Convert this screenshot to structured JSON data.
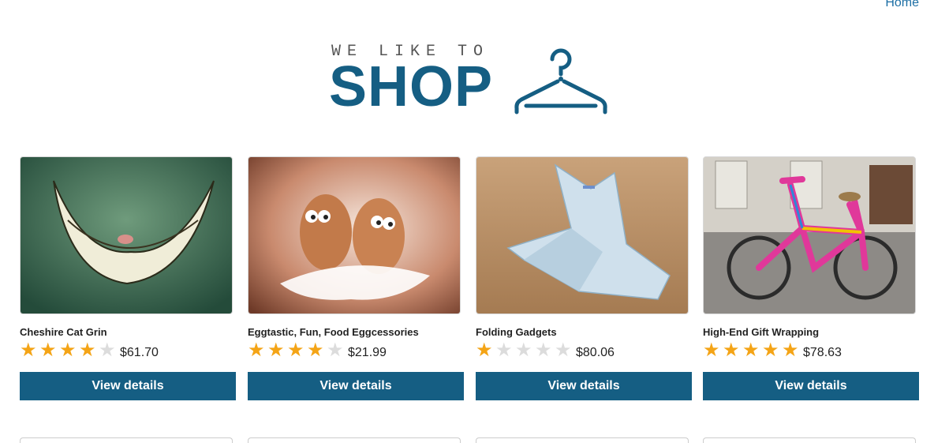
{
  "nav": {
    "home": "Home"
  },
  "logo": {
    "tagline": "WE LIKE TO",
    "wordmark": "SHOP",
    "icon": "hanger-icon"
  },
  "colors": {
    "brand": "#155e83",
    "star": "#f4a416",
    "star_off": "#dcdcdc",
    "link": "#1c6ea4"
  },
  "products": [
    {
      "title": "Cheshire Cat Grin",
      "rating": 4,
      "max_rating": 5,
      "price": "$61.70",
      "button": "View details",
      "image": "cheshire-cat-grin-image"
    },
    {
      "title": "Eggtastic, Fun, Food Eggcessories",
      "rating": 4,
      "max_rating": 5,
      "price": "$21.99",
      "button": "View details",
      "image": "eggs-image"
    },
    {
      "title": "Folding Gadgets",
      "rating": 1,
      "max_rating": 5,
      "price": "$80.06",
      "button": "View details",
      "image": "origami-banknote-image"
    },
    {
      "title": "High-End Gift Wrapping",
      "rating": 5,
      "max_rating": 5,
      "price": "$78.63",
      "button": "View details",
      "image": "yarn-bombed-bicycle-image"
    }
  ]
}
